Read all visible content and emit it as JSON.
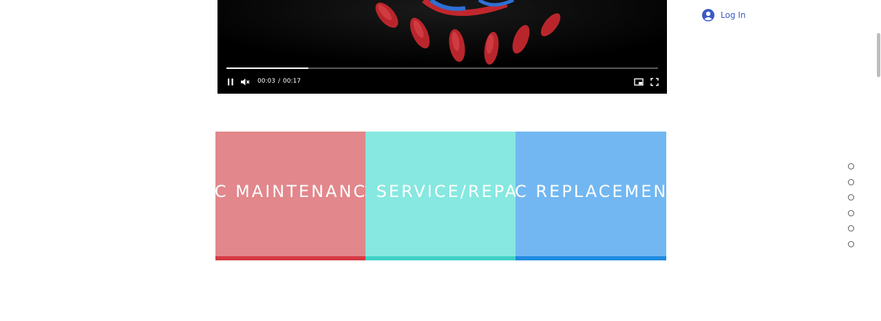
{
  "video": {
    "current_time": "00:03",
    "separator": "/",
    "duration": "00:17",
    "progress_fraction": 0.19,
    "colors": {
      "background": "#000000",
      "art_red": "#c0272d",
      "art_blue": "#2f6fd6"
    }
  },
  "login": {
    "label": "Log In",
    "color": "#3a58c7"
  },
  "services": [
    {
      "title": "AC MAINTENANCE",
      "bg": "#e2878b",
      "bar": "#d43a43"
    },
    {
      "title": "AC SERVICE/REPAIR",
      "bg": "#86e8e0",
      "bar": "#3fd1c6"
    },
    {
      "title": "AC REPLACEMENT",
      "bg": "#72b7f1",
      "bar": "#1e8ae0"
    }
  ],
  "section_nav": {
    "count": 6,
    "active_index": -1
  }
}
